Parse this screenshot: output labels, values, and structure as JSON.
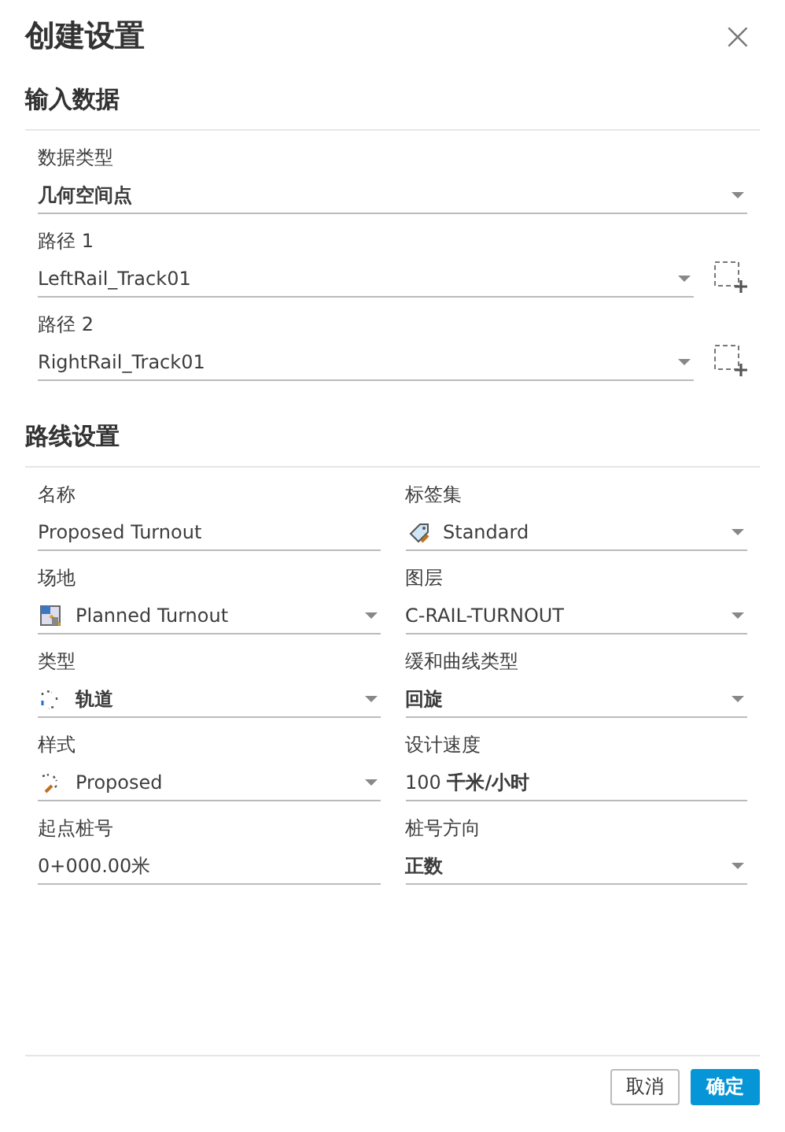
{
  "dialog": {
    "title": "创建设置",
    "close": "×"
  },
  "sections": [
    {
      "title": "输入数据",
      "kind": "list",
      "fields": [
        {
          "label": "数据类型",
          "value": "几何空间点",
          "kind": "dropdown",
          "bold": true
        },
        {
          "label": "路径 1",
          "value": "LeftRail_Track01",
          "kind": "dropdown",
          "bold": false,
          "pick": true
        },
        {
          "label": "路径 2",
          "value": "RightRail_Track01",
          "kind": "dropdown",
          "bold": false,
          "pick": true
        }
      ]
    },
    {
      "title": "路线设置",
      "kind": "grid",
      "fields": [
        {
          "label": "名称",
          "value": "Proposed Turnout",
          "kind": "text",
          "bold": false
        },
        {
          "label": "标签集",
          "value": "Standard",
          "kind": "icon-dropdown",
          "bold": false
        },
        {
          "label": "场地",
          "value": "Planned Turnout",
          "kind": "icon-dropdown",
          "bold": false
        },
        {
          "label": "图层",
          "value": "C-RAIL-TURNOUT",
          "kind": "dropdown",
          "bold": false
        },
        {
          "label": "类型",
          "value": "轨道",
          "kind": "icon-dropdown",
          "bold": true
        },
        {
          "label": "缓和曲线类型",
          "value": "回旋",
          "kind": "dropdown",
          "bold": true
        },
        {
          "label": "样式",
          "value": "Proposed",
          "kind": "icon-dropdown",
          "bold": false
        },
        {
          "label": "设计速度",
          "value": "100 **千米/小时**",
          "kind": "text",
          "bold": false
        },
        {
          "label": "起点桩号",
          "value": "0+000.00米",
          "kind": "text",
          "bold": false
        },
        {
          "label": "桩号方向",
          "value": "正数",
          "kind": "dropdown",
          "bold": true
        }
      ]
    }
  ],
  "buttons": [
    {
      "label": "取消",
      "kind": "secondary"
    },
    {
      "label": "确定",
      "kind": "primary"
    }
  ]
}
